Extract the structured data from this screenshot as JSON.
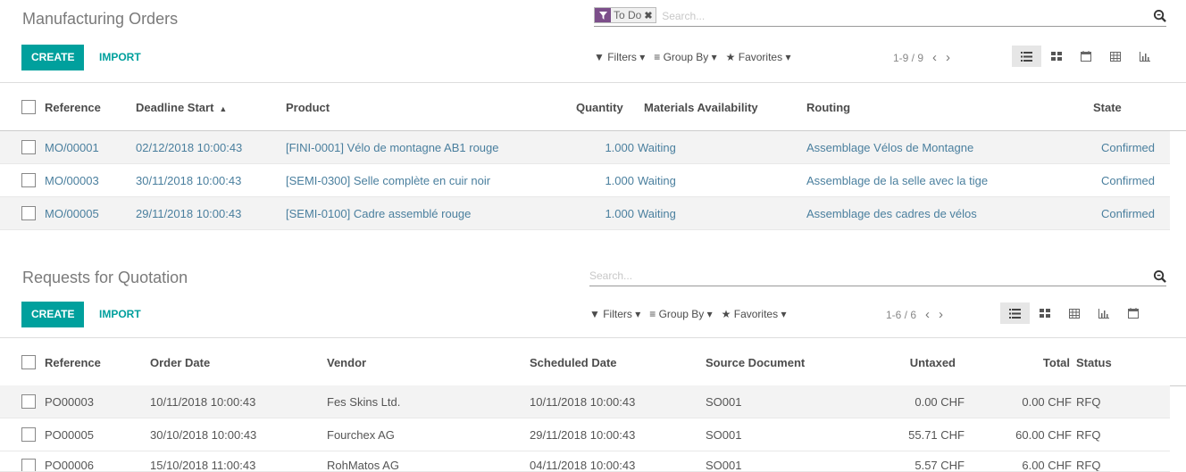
{
  "mo": {
    "title": "Manufacturing Orders",
    "create_label": "CREATE",
    "import_label": "IMPORT",
    "facet_label": "To Do",
    "search_placeholder": "Search...",
    "filters_label": "Filters",
    "groupby_label": "Group By",
    "favorites_label": "Favorites",
    "pager": "1-9 / 9",
    "columns": [
      "Reference",
      "Deadline Start",
      "Product",
      "Quantity",
      "Materials Availability",
      "Routing",
      "State"
    ],
    "sort_indicator": "▲",
    "rows": [
      {
        "ref": "MO/00001",
        "deadline": "02/12/2018 10:00:43",
        "product": "[FINI-0001] Vélo de montagne AB1 rouge",
        "qty": "1.000",
        "avail": "Waiting",
        "routing": "Assemblage Vélos de Montagne",
        "state": "Confirmed"
      },
      {
        "ref": "MO/00003",
        "deadline": "30/11/2018 10:00:43",
        "product": "[SEMI-0300] Selle complète en cuir noir",
        "qty": "1.000",
        "avail": "Waiting",
        "routing": "Assemblage de la selle avec la tige",
        "state": "Confirmed"
      },
      {
        "ref": "MO/00005",
        "deadline": "29/11/2018 10:00:43",
        "product": "[SEMI-0100] Cadre assemblé rouge",
        "qty": "1.000",
        "avail": "Waiting",
        "routing": "Assemblage des cadres de vélos",
        "state": "Confirmed"
      }
    ]
  },
  "rfq": {
    "title": "Requests for Quotation",
    "create_label": "CREATE",
    "import_label": "IMPORT",
    "search_placeholder": "Search...",
    "filters_label": "Filters",
    "groupby_label": "Group By",
    "favorites_label": "Favorites",
    "pager": "1-6 / 6",
    "columns": [
      "Reference",
      "Order Date",
      "Vendor",
      "Scheduled Date",
      "Source Document",
      "Untaxed",
      "Total",
      "Status"
    ],
    "rows": [
      {
        "ref": "PO00003",
        "order": "10/11/2018 10:00:43",
        "vendor": "Fes Skins Ltd.",
        "sched": "10/11/2018 10:00:43",
        "source": "SO001",
        "untaxed": "0.00 CHF",
        "total": "0.00 CHF",
        "status": "RFQ"
      },
      {
        "ref": "PO00005",
        "order": "30/10/2018 10:00:43",
        "vendor": "Fourchex AG",
        "sched": "29/11/2018 10:00:43",
        "source": "SO001",
        "untaxed": "55.71 CHF",
        "total": "60.00 CHF",
        "status": "RFQ"
      },
      {
        "ref": "PO00006",
        "order": "15/10/2018 11:00:43",
        "vendor": "RohMatos AG",
        "sched": "04/11/2018 10:00:43",
        "source": "SO001",
        "untaxed": "5.57 CHF",
        "total": "6.00 CHF",
        "status": "RFQ"
      }
    ]
  },
  "colors": {
    "accent": "#00a09d",
    "facet": "#7c4e8a",
    "link": "#4a7f9e"
  }
}
